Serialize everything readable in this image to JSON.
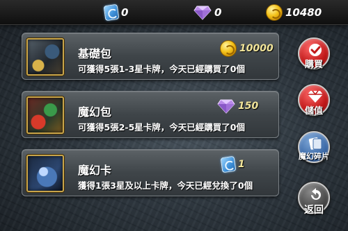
{
  "currency": {
    "card_fragments": "0",
    "gems": "0",
    "coins": "10480"
  },
  "packs": [
    {
      "title": "基礎包",
      "description": "可獲得5張1-3星卡牌，今天已經購買了0個",
      "price": "10000",
      "price_icon": "coin-icon"
    },
    {
      "title": "魔幻包",
      "description": "可獲得5張2-5星卡牌，今天已經購買了0個",
      "price": "150",
      "price_icon": "gem-icon"
    },
    {
      "title": "魔幻卡",
      "description": "獲得1張3星及以上卡牌，今天已經兌換了0個",
      "price": "1",
      "price_icon": "card-fragment-icon"
    }
  ],
  "side": {
    "buy": "購買",
    "store": "儲值",
    "fragments": "魔幻碎片",
    "back": "返回"
  },
  "colors": {
    "accent_red": "#c01818",
    "accent_blue": "#3c6aa8",
    "price_text": "#f2e59a"
  }
}
